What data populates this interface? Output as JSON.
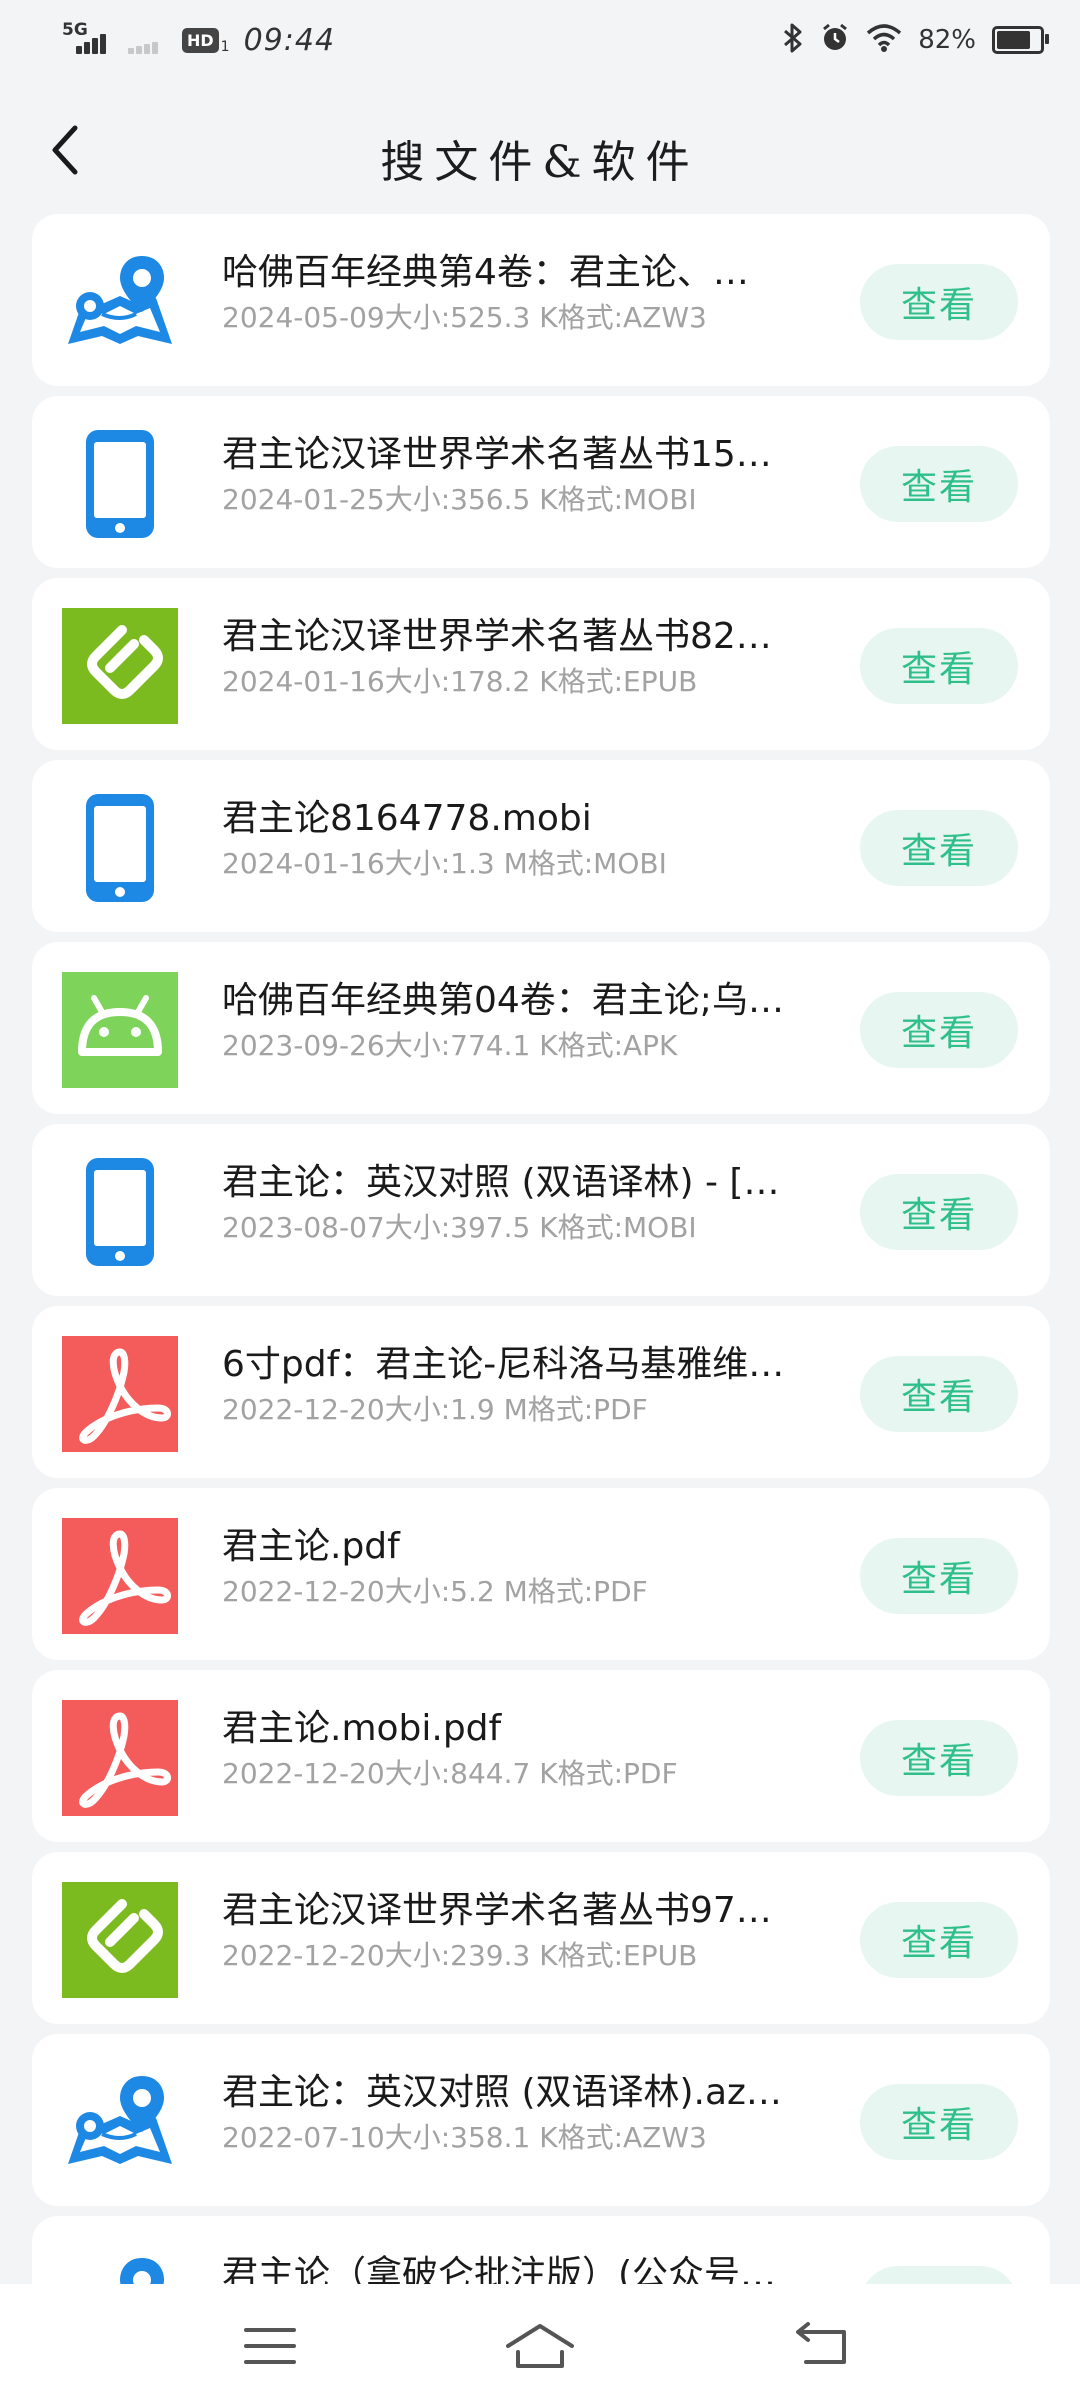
{
  "status_bar": {
    "network_label": "5G",
    "hd_label": "HD",
    "sim_index": "1",
    "time": "09:44",
    "battery_percent": "82%",
    "battery_level": 0.82,
    "icons": [
      "signal-icon",
      "bluetooth-icon",
      "alarm-icon",
      "wifi-icon",
      "battery-icon"
    ]
  },
  "header": {
    "title": "搜文件&软件",
    "back_icon": "back-chevron-icon"
  },
  "colors": {
    "background": "#f3f4f6",
    "card": "#ffffff",
    "view_button_bg": "#e8f6f1",
    "view_button_text": "#2fbf8a",
    "azw3_icon": "#1e88e5",
    "mobi_icon": "#1e88e5",
    "epub_icon": "#7cbb1f",
    "apk_icon": "#7ed35a",
    "pdf_icon": "#f45b5b"
  },
  "files": [
    {
      "name": "哈佛百年经典第4卷：君主论、…",
      "meta": "2024-05-09大小:525.3 K格式:AZW3",
      "type": "azw3",
      "icon": "map-pin-icon",
      "action": "查看"
    },
    {
      "name": "君主论汉译世界学术名著丛书15…",
      "meta": "2024-01-25大小:356.5 K格式:MOBI",
      "type": "mobi",
      "icon": "phone-icon",
      "action": "查看"
    },
    {
      "name": "君主论汉译世界学术名著丛书82…",
      "meta": "2024-01-16大小:178.2 K格式:EPUB",
      "type": "epub",
      "icon": "epub-icon",
      "action": "查看"
    },
    {
      "name": "君主论8164778.mobi",
      "meta": "2024-01-16大小:1.3 M格式:MOBI",
      "type": "mobi",
      "icon": "phone-icon",
      "action": "查看"
    },
    {
      "name": "哈佛百年经典第04卷：君主论;乌…",
      "meta": "2023-09-26大小:774.1 K格式:APK",
      "type": "apk",
      "icon": "android-icon",
      "action": "查看"
    },
    {
      "name": "君主论：英汉对照 (双语译林) - […",
      "meta": "2023-08-07大小:397.5 K格式:MOBI",
      "type": "mobi",
      "icon": "phone-icon",
      "action": "查看"
    },
    {
      "name": "6寸pdf：君主论-尼科洛马基雅维…",
      "meta": "2022-12-20大小:1.9 M格式:PDF",
      "type": "pdf",
      "icon": "pdf-icon",
      "action": "查看"
    },
    {
      "name": "君主论.pdf",
      "meta": "2022-12-20大小:5.2 M格式:PDF",
      "type": "pdf",
      "icon": "pdf-icon",
      "action": "查看"
    },
    {
      "name": "君主论.mobi.pdf",
      "meta": "2022-12-20大小:844.7 K格式:PDF",
      "type": "pdf",
      "icon": "pdf-icon",
      "action": "查看"
    },
    {
      "name": "君主论汉译世界学术名著丛书97…",
      "meta": "2022-12-20大小:239.3 K格式:EPUB",
      "type": "epub",
      "icon": "epub-icon",
      "action": "查看"
    },
    {
      "name": "君主论：英汉对照 (双语译林).az…",
      "meta": "2022-07-10大小:358.1 K格式:AZW3",
      "type": "azw3",
      "icon": "map-pin-icon",
      "action": "查看"
    },
    {
      "name": "君主论（拿破仑批注版）(公众号…",
      "meta": "",
      "type": "azw3",
      "icon": "map-pin-icon",
      "action": "查看"
    }
  ],
  "nav_bar": {
    "icons": [
      "menu-icon",
      "home-icon",
      "back-icon"
    ]
  }
}
